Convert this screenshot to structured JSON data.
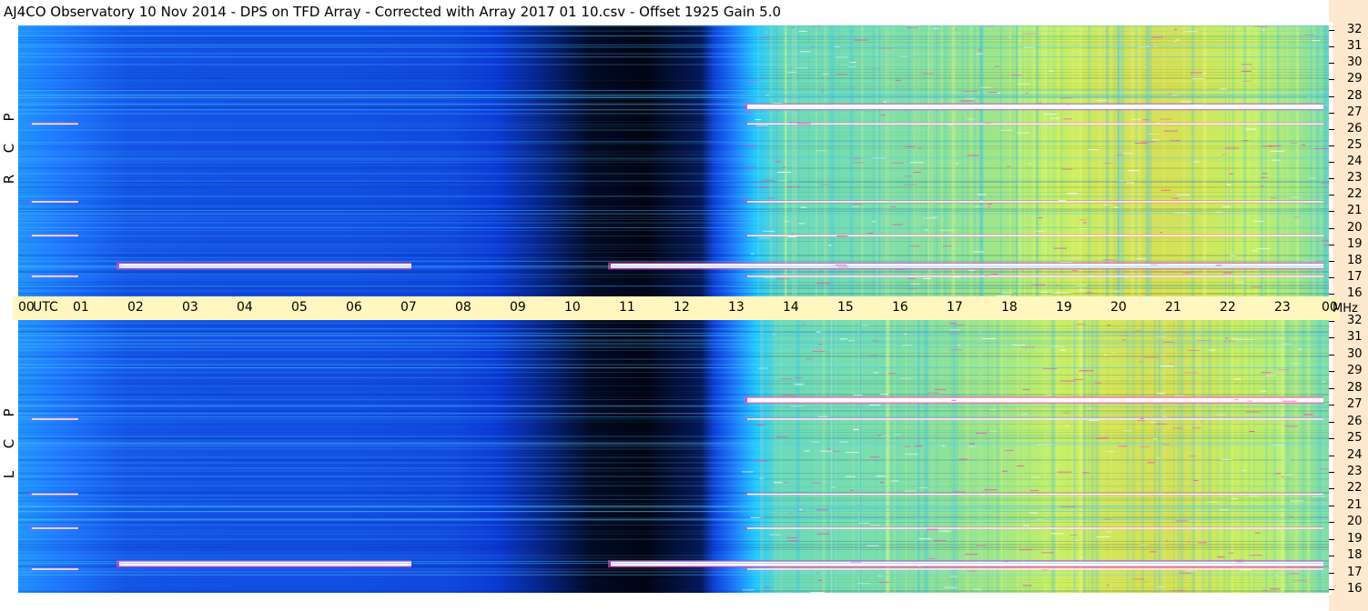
{
  "title": "AJ4CO Observatory  10 Nov 2014  -  DPS on TFD Array  -  Corrected with Array 2017 01 10.csv  -  Offset 1925  Gain 5.0",
  "panels": {
    "top_label": "R C P",
    "bottom_label": "L C P"
  },
  "x_axis": {
    "unit_label": "UTC",
    "ticks": [
      "00",
      "01",
      "02",
      "03",
      "04",
      "05",
      "06",
      "07",
      "08",
      "09",
      "10",
      "11",
      "12",
      "13",
      "14",
      "15",
      "16",
      "17",
      "18",
      "19",
      "20",
      "21",
      "22",
      "23",
      "00"
    ]
  },
  "y_axis": {
    "unit_label": "MHz",
    "ticks": [
      "32",
      "31",
      "30",
      "29",
      "28",
      "27",
      "26",
      "25",
      "24",
      "23",
      "22",
      "21",
      "20",
      "19",
      "18",
      "17",
      "16"
    ]
  },
  "colors": {
    "night_dark": "#000000",
    "night_blue": "#0b3bd6",
    "mid_blue": "#1f79ff",
    "cyan": "#22c8ff",
    "yellow_green": "#c8f060",
    "orange": "#ffc030",
    "rfi_white": "#ffffff",
    "rfi_magenta": "#ff40c0",
    "utc_bar": "#fff7bf",
    "right_strip": "#ffe8d0"
  },
  "chart_data": [
    {
      "type": "heatmap",
      "name": "R C P",
      "x": {
        "label": "UTC",
        "range": [
          0,
          24
        ],
        "ticks": [
          0,
          1,
          2,
          3,
          4,
          5,
          6,
          7,
          8,
          9,
          10,
          11,
          12,
          13,
          14,
          15,
          16,
          17,
          18,
          19,
          20,
          21,
          22,
          23,
          24
        ]
      },
      "y": {
        "label": "MHz",
        "range": [
          16,
          32
        ],
        "ticks": [
          16,
          17,
          18,
          19,
          20,
          21,
          22,
          23,
          24,
          25,
          26,
          27,
          28,
          29,
          30,
          31,
          32
        ]
      },
      "profile": {
        "hours": [
          0,
          1,
          2,
          4,
          6,
          8,
          9.5,
          10.5,
          11.5,
          12.5,
          13,
          13.5,
          14,
          16,
          18,
          20,
          21,
          23,
          24
        ],
        "levels": [
          0.36,
          0.28,
          0.2,
          0.18,
          0.18,
          0.16,
          0.08,
          0.02,
          0.01,
          0.05,
          0.25,
          0.48,
          0.56,
          0.58,
          0.62,
          0.7,
          0.72,
          0.64,
          0.58
        ]
      },
      "rfi_bands_mhz": [
        27.2,
        17.8,
        26.2,
        21.6,
        19.6,
        17.2
      ]
    },
    {
      "type": "heatmap",
      "name": "L C P",
      "x": {
        "label": "UTC",
        "range": [
          0,
          24
        ],
        "ticks": [
          0,
          1,
          2,
          3,
          4,
          5,
          6,
          7,
          8,
          9,
          10,
          11,
          12,
          13,
          14,
          15,
          16,
          17,
          18,
          19,
          20,
          21,
          22,
          23,
          24
        ]
      },
      "y": {
        "label": "MHz",
        "range": [
          16,
          32
        ],
        "ticks": [
          16,
          17,
          18,
          19,
          20,
          21,
          22,
          23,
          24,
          25,
          26,
          27,
          28,
          29,
          30,
          31,
          32
        ]
      },
      "profile": {
        "hours": [
          0,
          1,
          2,
          4,
          6,
          8,
          9.5,
          10.5,
          11.5,
          12.5,
          13,
          13.5,
          14,
          16,
          18,
          20,
          21,
          23,
          24
        ],
        "levels": [
          0.36,
          0.28,
          0.2,
          0.18,
          0.18,
          0.16,
          0.08,
          0.02,
          0.01,
          0.05,
          0.25,
          0.48,
          0.56,
          0.58,
          0.62,
          0.7,
          0.72,
          0.64,
          0.58
        ]
      },
      "rfi_bands_mhz": [
        27.3,
        17.7,
        26.2,
        21.8,
        19.8,
        17.4
      ]
    }
  ]
}
